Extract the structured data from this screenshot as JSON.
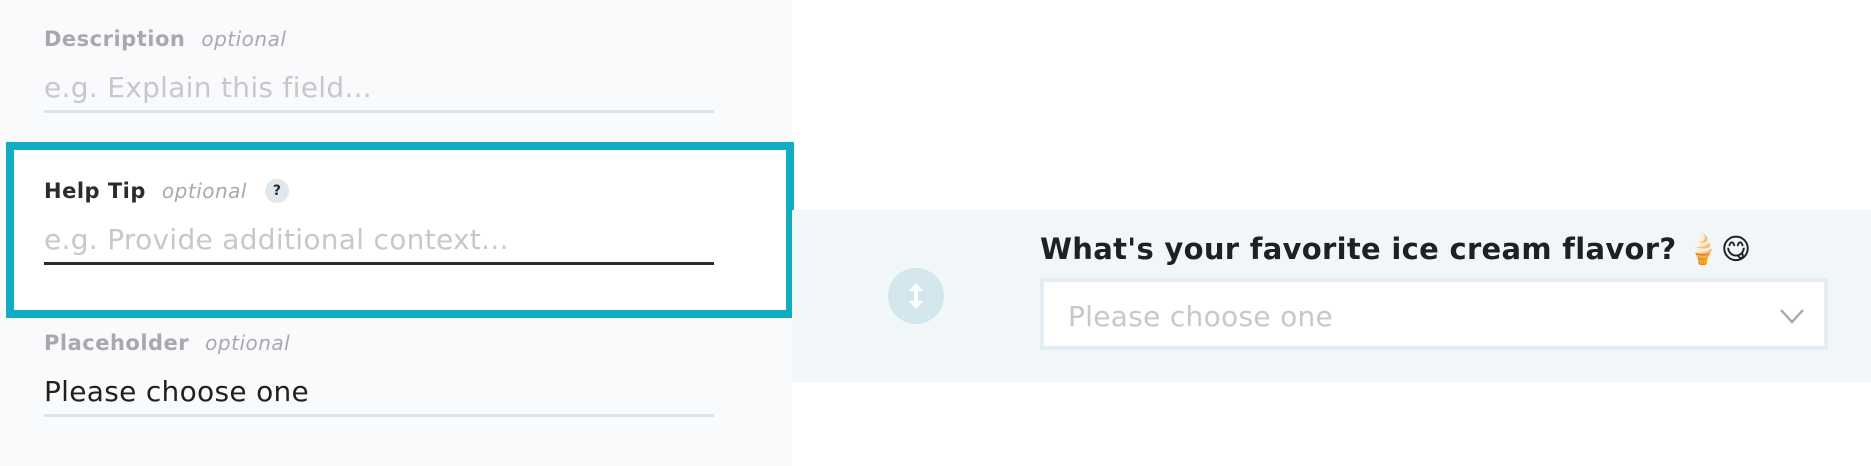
{
  "settings": {
    "description": {
      "label": "Description",
      "optional": "optional",
      "placeholder": "e.g. Explain this field...",
      "value": ""
    },
    "help_tip": {
      "label": "Help Tip",
      "optional": "optional",
      "badge": "?",
      "placeholder": "e.g. Provide additional context...",
      "value": ""
    },
    "placeholder": {
      "label": "Placeholder",
      "optional": "optional",
      "value": "Please choose one"
    }
  },
  "preview": {
    "question": "What's your favorite ice cream flavor?",
    "question_emoji": "🍦😋",
    "select_placeholder": "Please choose one"
  },
  "colors": {
    "highlight": "#10acc4",
    "preview_bg": "#f1f6f8",
    "handle_bg": "#d3e7ed"
  },
  "icons": {
    "drag_handle": "vertical-arrows-icon",
    "select_toggle": "chevron-down-icon",
    "help": "question-mark-icon"
  }
}
